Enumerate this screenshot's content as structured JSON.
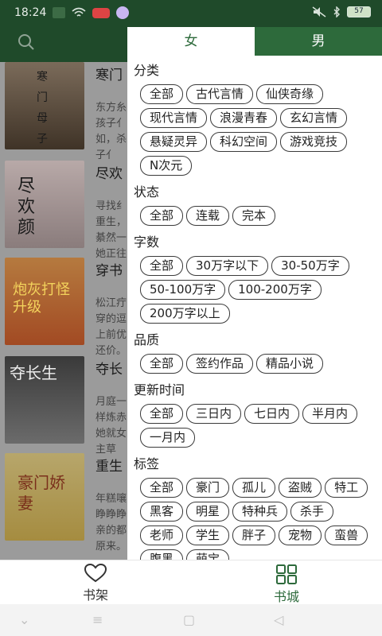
{
  "status_bar": {
    "time": "18:24",
    "battery": "57"
  },
  "background": {
    "books": [
      {
        "title": "寒门",
        "desc": "东方糸孩子亻如，杀子亻",
        "cover_text": "寒门母子"
      },
      {
        "title": "尽欢",
        "desc": "寻找纟重生，綦然一她正往",
        "cover_text": "尽欢颜"
      },
      {
        "title": "穿书",
        "desc": "松江疔穿的逗上前优还价。",
        "cover_text": "炮灰打怪升级"
      },
      {
        "title": "夺长",
        "desc": "月庭一样炼赤她就女主草",
        "cover_text": "夺长生"
      },
      {
        "title": "重生",
        "desc": "年糕嚷睁睁睁亲的都原来。",
        "cover_text": "豪门娇妻"
      }
    ]
  },
  "drawer": {
    "tabs": [
      {
        "label": "女"
      },
      {
        "label": "男"
      }
    ],
    "sections": [
      {
        "title": "分类",
        "chips": [
          "全部",
          "古代言情",
          "仙侠奇缘",
          "现代言情",
          "浪漫青春",
          "玄幻言情",
          "悬疑灵异",
          "科幻空间",
          "游戏竞技",
          "N次元"
        ]
      },
      {
        "title": "状态",
        "chips": [
          "全部",
          "连载",
          "完本"
        ]
      },
      {
        "title": "字数",
        "chips": [
          "全部",
          "30万字以下",
          "30-50万字",
          "50-100万字",
          "100-200万字",
          "200万字以上"
        ]
      },
      {
        "title": "品质",
        "chips": [
          "全部",
          "签约作品",
          "精品小说"
        ]
      },
      {
        "title": "更新时间",
        "chips": [
          "全部",
          "三日内",
          "七日内",
          "半月内",
          "一月内"
        ]
      },
      {
        "title": "标签",
        "chips": [
          "全部",
          "豪门",
          "孤儿",
          "盗贼",
          "特工",
          "黑客",
          "明星",
          "特种兵",
          "杀手",
          "老师",
          "学生",
          "胖子",
          "宠物",
          "蛮兽",
          "腹黑",
          "萌宝"
        ]
      }
    ]
  },
  "bottom_nav": {
    "shelf_label": "书架",
    "store_label": "书城"
  },
  "colors": {
    "accent": "#2d6a3b",
    "header": "#1f4a2a"
  }
}
